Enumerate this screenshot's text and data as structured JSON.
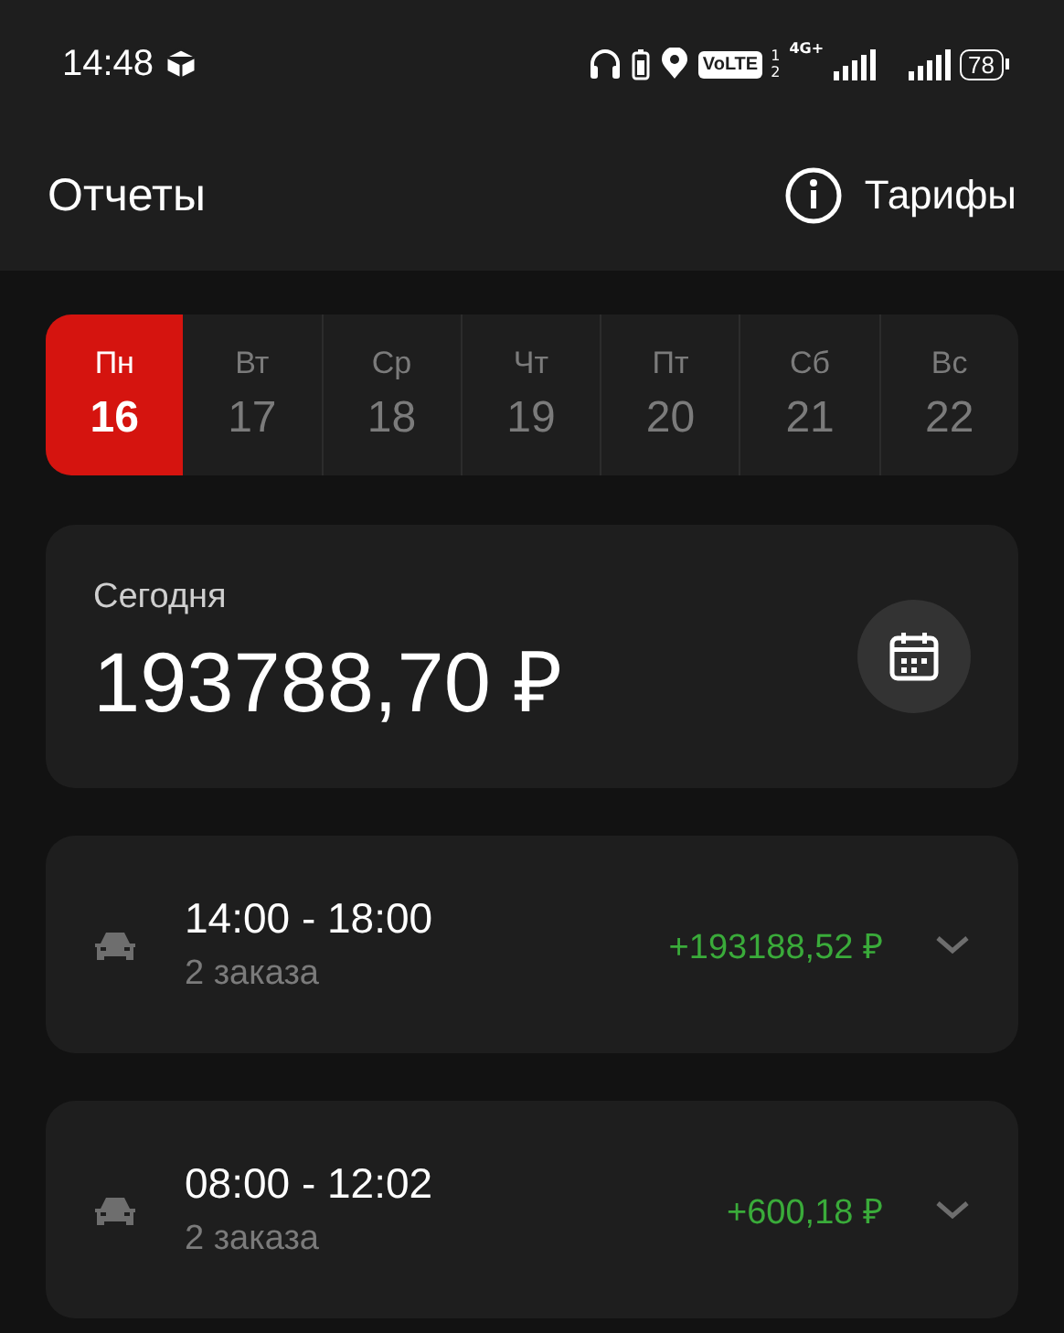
{
  "status_bar": {
    "time": "14:48",
    "volte": "VoLTE",
    "sim_1": "1",
    "sim_2": "2",
    "network": "4G+",
    "battery": "78"
  },
  "header": {
    "title": "Отчеты",
    "tariffs_link": "Тарифы"
  },
  "week": [
    {
      "day": "Пн",
      "date": "16",
      "selected": true
    },
    {
      "day": "Вт",
      "date": "17",
      "selected": false
    },
    {
      "day": "Ср",
      "date": "18",
      "selected": false
    },
    {
      "day": "Чт",
      "date": "19",
      "selected": false
    },
    {
      "day": "Пт",
      "date": "20",
      "selected": false
    },
    {
      "day": "Сб",
      "date": "21",
      "selected": false
    },
    {
      "day": "Вс",
      "date": "22",
      "selected": false
    }
  ],
  "today": {
    "label": "Сегодня",
    "amount": "193788,70 ₽"
  },
  "shifts": [
    {
      "time": "14:00 - 18:00",
      "orders": "2 заказа",
      "amount": "+193188,52 ₽",
      "expanded": false
    },
    {
      "time": "08:00 - 12:02",
      "orders": "2 заказа",
      "amount": "+600,18 ₽",
      "expanded": false
    }
  ]
}
